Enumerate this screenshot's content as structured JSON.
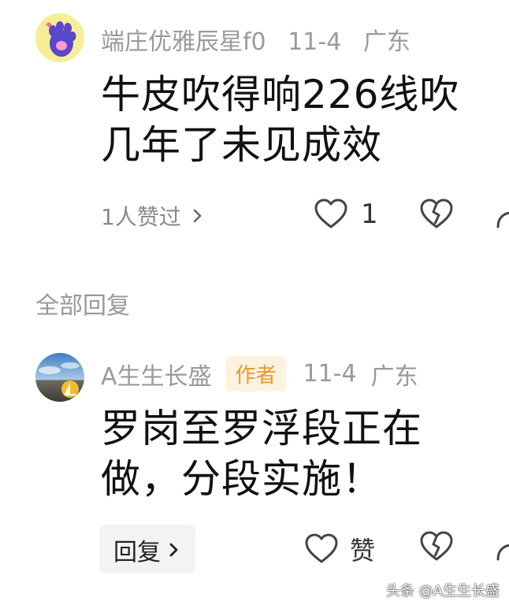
{
  "comment": {
    "username": "端庄优雅辰星f0",
    "date": "11-4",
    "location": "广东",
    "text_line1": "牛皮吹得响226线吹",
    "text_line2": "几年了未见成效",
    "likers_label": "1人赞过",
    "like_count": "1"
  },
  "replies_section": {
    "title": "全部回复"
  },
  "reply": {
    "username": "A生生长盛",
    "badge": "作者",
    "date": "11-4",
    "location": "广东",
    "text_line1": "罗岗至罗浮段正在",
    "text_line2": "做，分段实施！",
    "reply_button_label": "回复",
    "like_label": "赞"
  },
  "watermark": {
    "text": "头条 @A生生长盛"
  }
}
